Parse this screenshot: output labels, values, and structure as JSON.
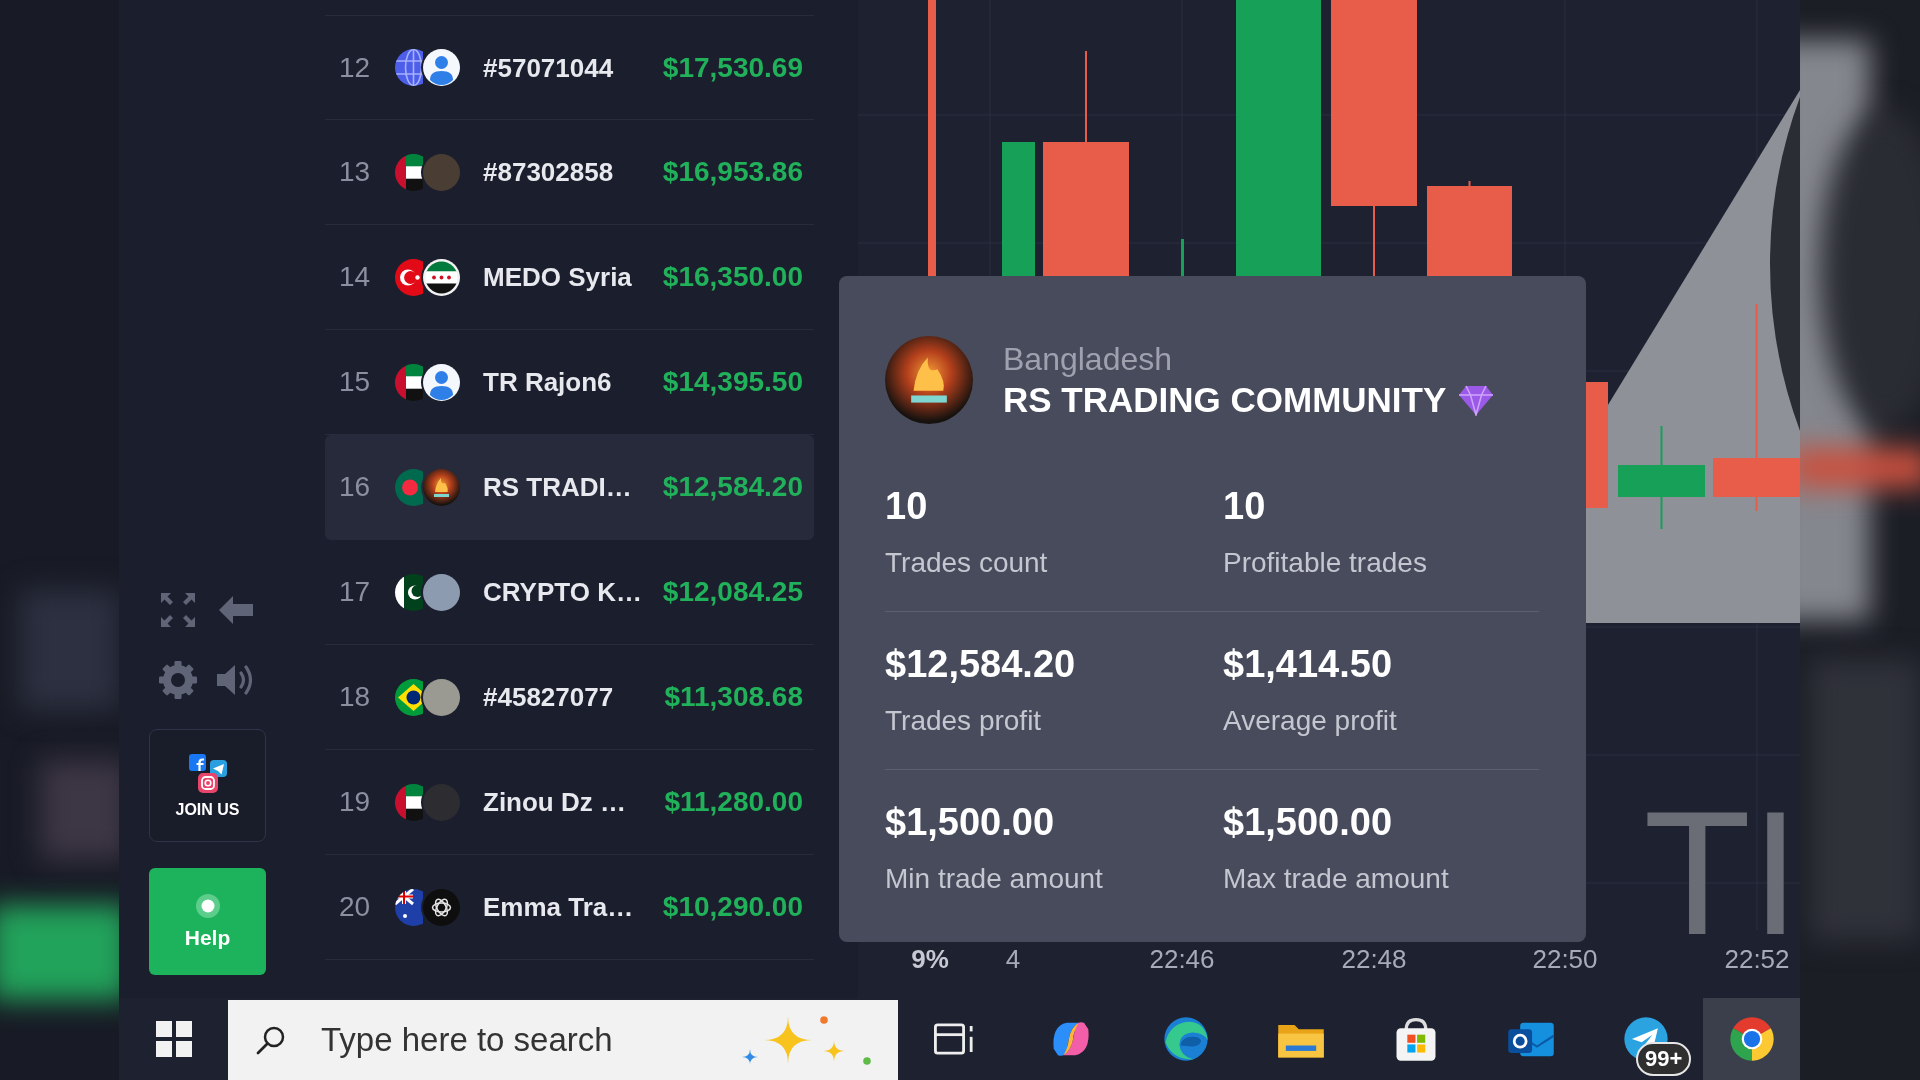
{
  "side_panel": {
    "join_label": "JOIN US",
    "help_label": "Help"
  },
  "leaderboard": {
    "rows": [
      {
        "rank": "12",
        "flag": {
          "kind": "globe"
        },
        "avatar": {
          "kind": "user"
        },
        "name": "#57071044",
        "profit": "$17,530.69",
        "selected": false
      },
      {
        "rank": "13",
        "flag": {
          "kind": "uae"
        },
        "avatar": {
          "kind": "photo"
        },
        "name": "#87302858",
        "profit": "$16,953.86",
        "selected": false
      },
      {
        "rank": "14",
        "flag": {
          "kind": "turkey"
        },
        "avatar": {
          "kind": "syria-flag"
        },
        "name": "MEDO Syria",
        "profit": "$16,350.00",
        "selected": false
      },
      {
        "rank": "15",
        "flag": {
          "kind": "uae"
        },
        "avatar": {
          "kind": "user"
        },
        "name": "TR Rajon6",
        "profit": "$14,395.50",
        "selected": false
      },
      {
        "rank": "16",
        "flag": {
          "kind": "bangladesh"
        },
        "avatar": {
          "kind": "flame-logo"
        },
        "name": "RS TRADI…",
        "profit": "$12,584.20",
        "selected": true
      },
      {
        "rank": "17",
        "flag": {
          "kind": "pakistan"
        },
        "avatar": {
          "kind": "photo"
        },
        "name": "CRYPTO K…",
        "profit": "$12,084.25",
        "selected": false
      },
      {
        "rank": "18",
        "flag": {
          "kind": "brazil"
        },
        "avatar": {
          "kind": "photo"
        },
        "name": "#45827077",
        "profit": "$11,308.68",
        "selected": false
      },
      {
        "rank": "19",
        "flag": {
          "kind": "uae"
        },
        "avatar": {
          "kind": "photo"
        },
        "name": "Zinou Dz …",
        "profit": "$11,280.00",
        "selected": false
      },
      {
        "rank": "20",
        "flag": {
          "kind": "blue-ensign"
        },
        "avatar": {
          "kind": "knot-logo"
        },
        "name": "Emma Tra…",
        "profit": "$10,290.00",
        "selected": false
      }
    ]
  },
  "chart": {
    "corner_label": "9%",
    "time_labels": [
      "4",
      "22:46",
      "22:48",
      "22:50",
      "22:52"
    ],
    "background_text": "TI"
  },
  "profile_card": {
    "country": "Bangladesh",
    "name": "RS TRADING COMMUNITY",
    "stats": [
      {
        "value": "10",
        "label": "Trades count"
      },
      {
        "value": "10",
        "label": "Profitable trades"
      },
      {
        "value": "$12,584.20",
        "label": "Trades profit"
      },
      {
        "value": "$1,414.50",
        "label": "Average profit"
      },
      {
        "value": "$1,500.00",
        "label": "Min trade amount"
      },
      {
        "value": "$1,500.00",
        "label": "Max trade amount"
      }
    ]
  },
  "taskbar": {
    "search": {
      "placeholder": "Type here to search"
    },
    "apps": [
      {
        "kind": "task-view",
        "active": false
      },
      {
        "kind": "copilot",
        "active": false
      },
      {
        "kind": "edge",
        "active": false
      },
      {
        "kind": "explorer",
        "active": false
      },
      {
        "kind": "store",
        "active": false
      },
      {
        "kind": "outlook",
        "active": false
      },
      {
        "kind": "telegram",
        "active": false,
        "badge": "99+"
      },
      {
        "kind": "chrome",
        "active": true
      }
    ]
  }
}
